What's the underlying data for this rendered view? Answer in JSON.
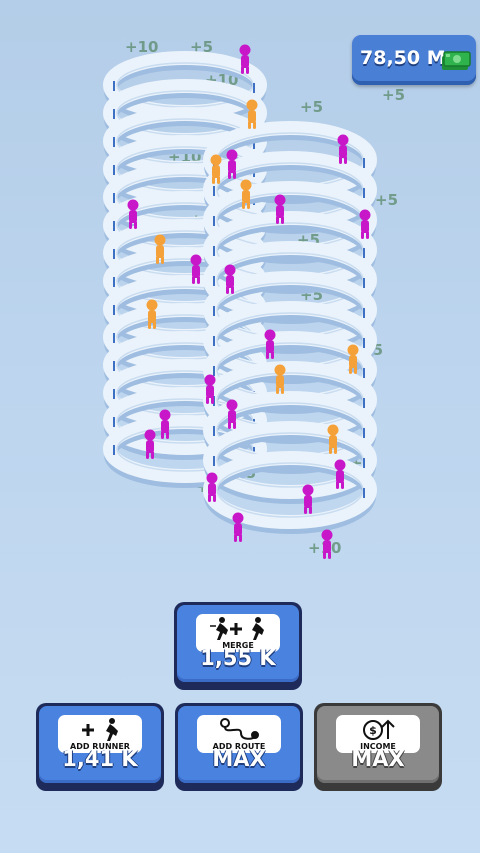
{
  "money": {
    "value": "78,50 M",
    "icon": "cash-stack-icon"
  },
  "floating_bonuses": [
    "+10",
    "+5",
    "+10",
    "+5",
    "+5",
    "+10",
    "+5",
    "+5",
    "+5",
    "+5",
    "+10",
    "+5",
    "+5",
    "+5",
    "+5",
    "+5",
    "+5",
    "+5",
    "+10"
  ],
  "buttons": {
    "merge": {
      "label": "MERGE",
      "price": "1,55 K",
      "icon": "merge-runners-icon"
    },
    "add_runner": {
      "label": "ADD RUNNER",
      "price": "1,41 K",
      "icon": "add-runner-icon"
    },
    "add_route": {
      "label": "ADD ROUTE",
      "price": "MAX",
      "icon": "route-icon"
    },
    "income": {
      "label": "INCOME",
      "price": "MAX",
      "icon": "income-icon"
    }
  },
  "colors": {
    "background": "#bdd5ee",
    "track": "#eaf3fb",
    "runner_primary": "#c817c8",
    "runner_secondary": "#f5a13a",
    "button_blue": "#4a82e0",
    "button_grey": "#8a8a8a"
  }
}
